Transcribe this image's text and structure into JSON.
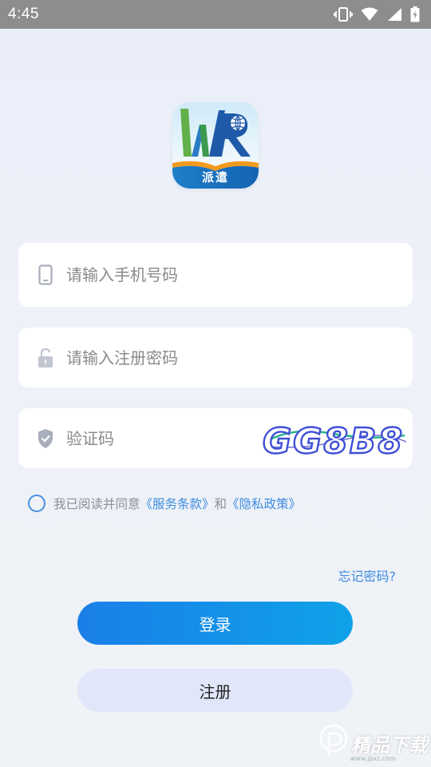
{
  "status_bar": {
    "time": "4:45",
    "icons": [
      "vibrate-icon",
      "wifi-icon",
      "signal-icon",
      "battery-icon"
    ]
  },
  "logo": {
    "letters": "WR",
    "text": "派遣"
  },
  "phone_field": {
    "placeholder": "请输入手机号码",
    "value": "",
    "icon": "phone-icon"
  },
  "password_field": {
    "placeholder": "请输入注册密码",
    "value": "",
    "icon": "lock-icon"
  },
  "captcha_field": {
    "placeholder": "验证码",
    "value": "",
    "icon": "shield-icon",
    "captcha_text": "GG8B8"
  },
  "agreement": {
    "prefix": "我已阅读并同意",
    "terms": "《服务条款》",
    "and": "和",
    "privacy": "《隐私政策》"
  },
  "forgot_password": "忘记密码?",
  "login_button": "登录",
  "register_button": "注册",
  "watermark": {
    "text": "精品下载",
    "url": "www.jpxz.com"
  },
  "colors": {
    "accent": "#1a7fe8",
    "link": "#3d8be0",
    "register_bg": "#e1e6fb",
    "status_bar": "#8d8d8d"
  }
}
